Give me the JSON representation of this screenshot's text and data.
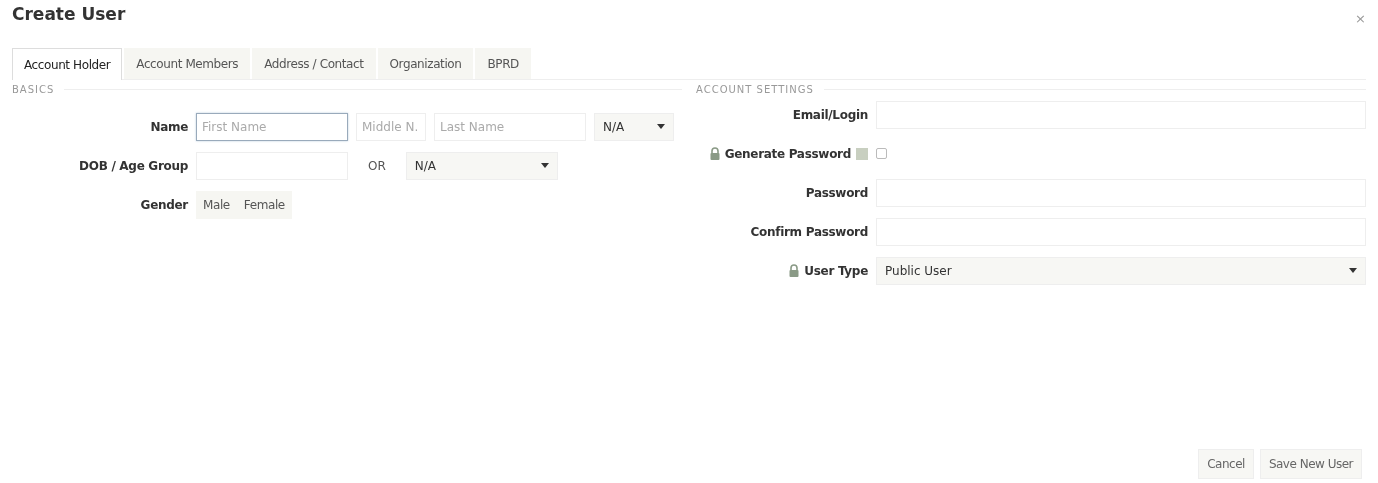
{
  "window": {
    "title": "Create User",
    "close": "×"
  },
  "tabs": [
    {
      "label": "Account Holder",
      "selected": true
    },
    {
      "label": "Account Members",
      "selected": false
    },
    {
      "label": "Address / Contact",
      "selected": false
    },
    {
      "label": "Organization",
      "selected": false
    },
    {
      "label": "BPRD",
      "selected": false
    }
  ],
  "basics": {
    "heading": "BASICS",
    "rows": [
      {
        "label": "Name",
        "controls": [
          {
            "kind": "text",
            "placeholder": "First Name",
            "focused": true
          },
          {
            "kind": "text",
            "placeholder": "Middle N.",
            "focused": false
          },
          {
            "kind": "text",
            "placeholder": "Last Name",
            "focused": false
          },
          {
            "kind": "select",
            "value": "N/A"
          }
        ]
      },
      {
        "label": "DOB / Age Group",
        "controls": [
          {
            "kind": "text",
            "focused": false
          },
          {
            "kind": "word",
            "text": "OR"
          },
          {
            "kind": "select",
            "value": "N/A"
          }
        ]
      },
      {
        "label": "Gender",
        "controls": [
          {
            "kind": "toggle",
            "options": [
              {
                "label": "Male",
                "selected": false
              },
              {
                "label": "Female",
                "selected": false
              }
            ]
          }
        ]
      }
    ]
  },
  "account_settings": {
    "heading": "ACCOUNT SETTINGS",
    "rows": [
      {
        "label": "Email/Login",
        "kind": "text",
        "locked": false
      },
      {
        "label": "Generate Password",
        "kind": "checkbox",
        "locked": true,
        "checked": false
      },
      {
        "label": "Password",
        "kind": "text",
        "locked": false
      },
      {
        "label": "Confirm Password",
        "kind": "text",
        "locked": false
      },
      {
        "label": "User Type",
        "kind": "select",
        "locked": true,
        "value": "Public User"
      }
    ]
  },
  "buttons": [
    "Cancel",
    "Save New User"
  ]
}
